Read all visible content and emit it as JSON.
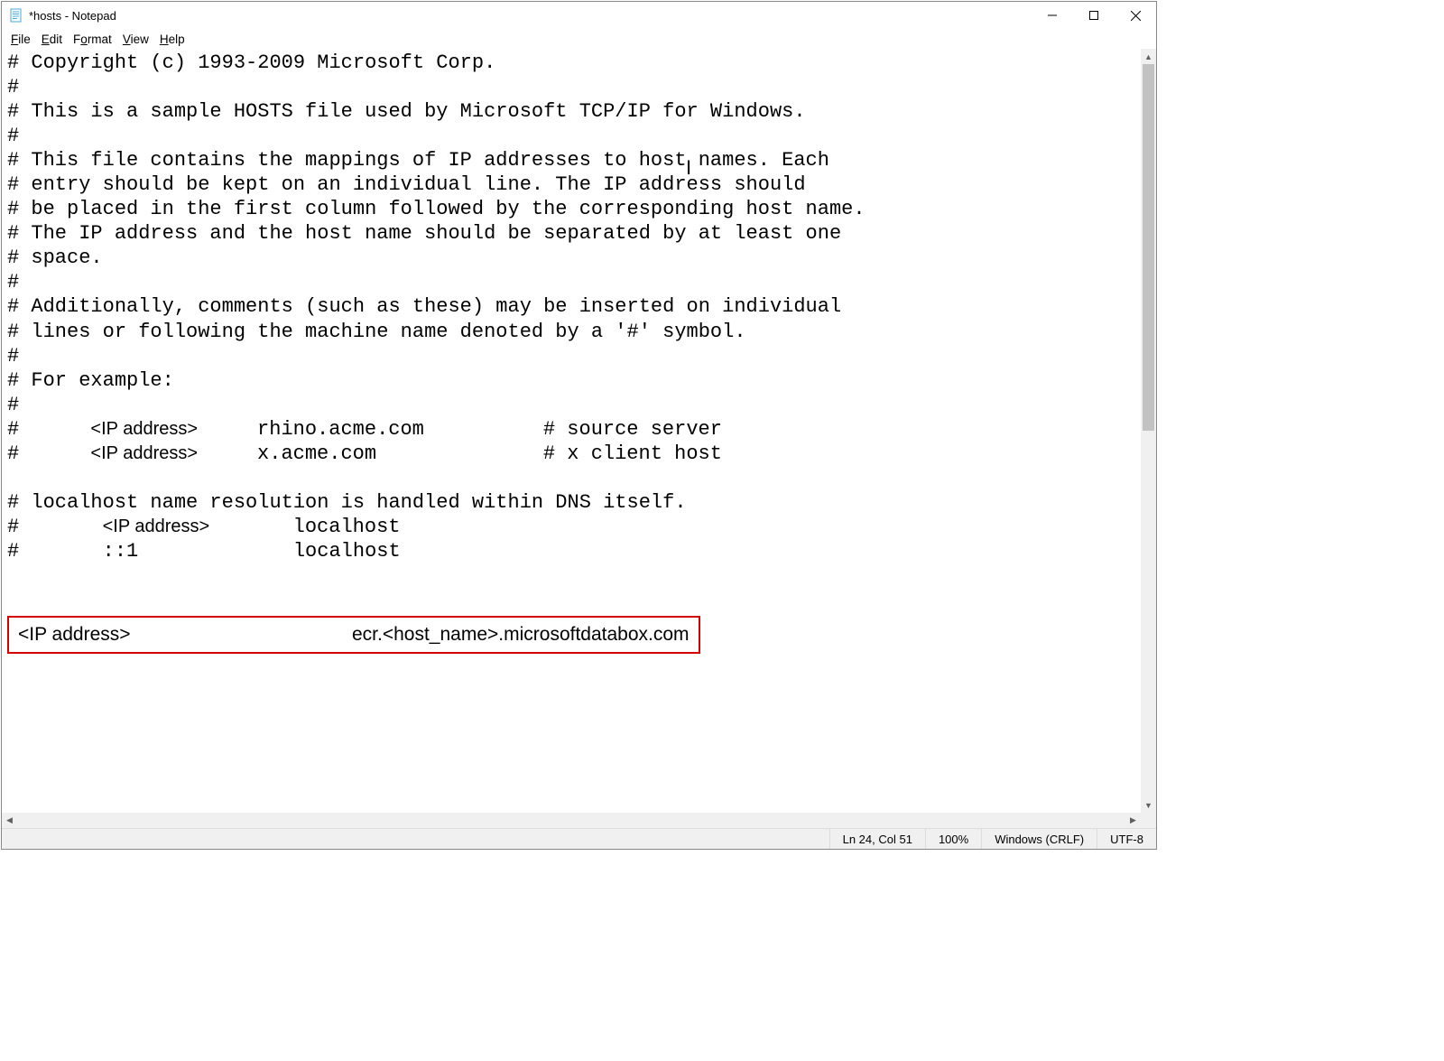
{
  "title": "*hosts - Notepad",
  "menu": {
    "file": "File",
    "edit": "Edit",
    "format": "Format",
    "view": "View",
    "help": "Help"
  },
  "content": {
    "line01": "# Copyright (c) 1993-2009 Microsoft Corp.",
    "line02": "#",
    "line03": "# This is a sample HOSTS file used by Microsoft TCP/IP for Windows.",
    "line04": "#",
    "line05": "# This file contains the mappings of IP addresses to host names. Each",
    "line06": "# entry should be kept on an individual line. The IP address should",
    "line07": "# be placed in the first column followed by the corresponding host name.",
    "line08": "# The IP address and the host name should be separated by at least one",
    "line09": "# space.",
    "line10": "#",
    "line11": "# Additionally, comments (such as these) may be inserted on individual",
    "line12": "# lines or following the machine name denoted by a '#' symbol.",
    "line13": "#",
    "line14": "# For example:",
    "line15": "#",
    "line16a": "#      ",
    "line16b": "<IP address>",
    "line16c": "     rhino.acme.com          # source server",
    "line17a": "#      ",
    "line17b": "<IP address>",
    "line17c": "     x.acme.com              # x client host",
    "line18": "",
    "line19": "# localhost name resolution is handled within DNS itself.",
    "line20a": "#       ",
    "line20b": "<IP address>",
    "line20c": "       localhost",
    "line21": "#       ::1             localhost",
    "highlight_ip": "<IP address>",
    "highlight_host": "ecr.<host_name>.microsoftdatabox.com"
  },
  "status": {
    "position": "Ln 24, Col 51",
    "zoom": "100%",
    "line_ending": "Windows (CRLF)",
    "encoding": "UTF-8"
  }
}
